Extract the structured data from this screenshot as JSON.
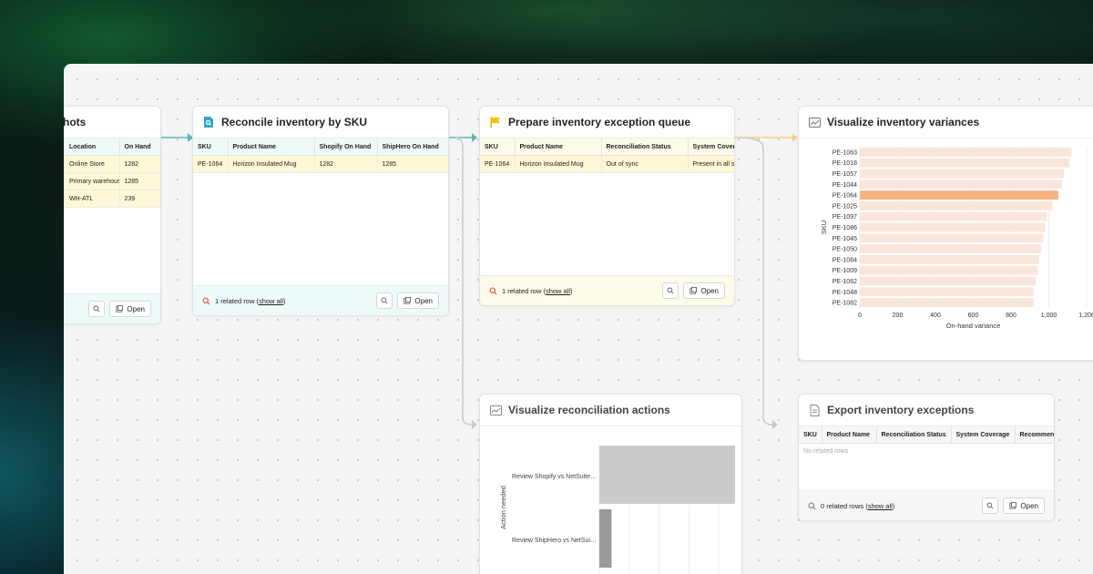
{
  "cards": {
    "snapshots": {
      "title": "hots",
      "columns": [
        "Location",
        "On Hand"
      ],
      "rows": [
        [
          "Online Store",
          "1282"
        ],
        [
          "Primary warehouse",
          "1285"
        ],
        [
          "WH-ATL",
          "239"
        ]
      ],
      "open_label": "Open"
    },
    "reconcile": {
      "title": "Reconcile inventory by SKU",
      "columns": [
        "SKU",
        "Product Name",
        "Shopify On Hand",
        "ShipHero On Hand"
      ],
      "rows": [
        [
          "PE-1064",
          "Horizon Insulated Mug",
          "1282",
          "1285"
        ]
      ],
      "footer_prefix": "1 related row (",
      "footer_link": "show all",
      "footer_suffix": ")",
      "open_label": "Open"
    },
    "exception_queue": {
      "title": "Prepare inventory exception queue",
      "columns": [
        "SKU",
        "Product Name",
        "Reconciliation Status",
        "System Coverage"
      ],
      "rows": [
        [
          "PE-1064",
          "Horizon Insulated Mug",
          "Out of sync",
          "Present in all systems"
        ]
      ],
      "footer_prefix": "1 related row (",
      "footer_link": "show all",
      "footer_suffix": ")",
      "open_label": "Open"
    },
    "variances": {
      "title": "Visualize inventory variances"
    },
    "recon_actions": {
      "title": "Visualize reconciliation actions"
    },
    "export": {
      "title": "Export inventory exceptions",
      "columns": [
        "SKU",
        "Product Name",
        "Reconciliation Status",
        "System Coverage",
        "Recommended"
      ],
      "empty_text": "No related rows",
      "footer_prefix": "0 related rows (",
      "footer_link": "show all",
      "footer_suffix": ")",
      "open_label": "Open"
    }
  },
  "colors": {
    "teal_edge": "#5ab8b8",
    "yellow_edge": "#f2d27a",
    "gray_edge": "#c9c9c9",
    "reconcile_tint": "#eefafa",
    "queue_tint": "#fffbea",
    "row_highlight": "#fff8d6",
    "bar_highlight": "#f5b47f",
    "bar_normal": "#f9e6da"
  },
  "chart_data": [
    {
      "type": "bar",
      "orientation": "horizontal",
      "categories": [
        "PE-1063",
        "PE-1018",
        "PE-1057",
        "PE-1044",
        "PE-1064",
        "PE-1025",
        "PE-1097",
        "PE-1086",
        "PE-1045",
        "PE-1050",
        "PE-1084",
        "PE-1009",
        "PE-1062",
        "PE-1048",
        "PE-1082"
      ],
      "values": [
        1120,
        1110,
        1080,
        1070,
        1050,
        1020,
        990,
        980,
        970,
        960,
        950,
        940,
        930,
        920,
        920
      ],
      "highlight": "PE-1064",
      "xlabel": "On-hand variance",
      "ylabel": "SKU",
      "xticks": [
        "0",
        "200",
        "400",
        "600",
        "800",
        "1,000",
        "1,200"
      ],
      "xlim": [
        0,
        1200
      ],
      "grid": true
    },
    {
      "type": "bar",
      "orientation": "horizontal",
      "categories": [
        "Review Shopify vs NetSuite…",
        "Review ShipHero vs NetSui…"
      ],
      "values": [
        1,
        0.09
      ],
      "ylabel": "Action needed",
      "grid": true
    }
  ]
}
